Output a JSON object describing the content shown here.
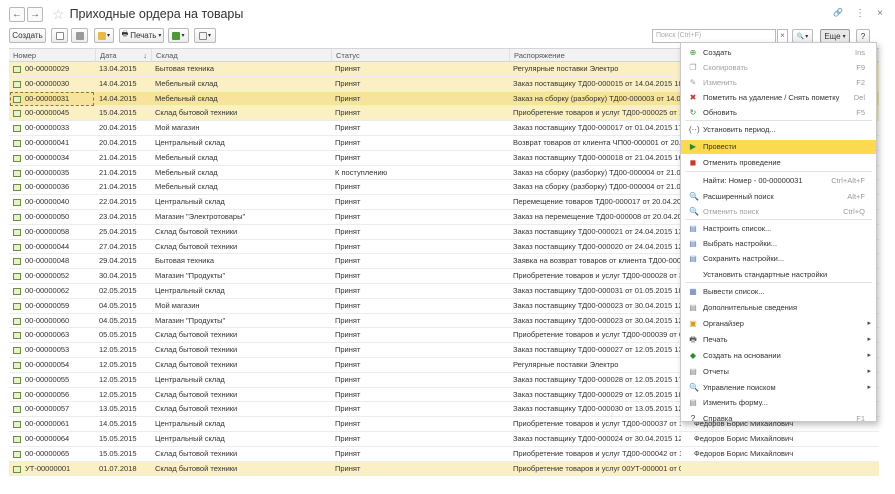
{
  "window": {
    "title": "Приходные ордера на товары",
    "back_glyph": "←",
    "forward_glyph": "→",
    "star_glyph": "☆",
    "link_glyph": "🔗",
    "more_glyph": "⋮",
    "close_glyph": "×"
  },
  "toolbar": {
    "create_label": "Создать",
    "print_label": "Печать",
    "search_placeholder": "Поиск (Ctrl+F)",
    "clear_glyph": "×",
    "search_glyph": "🔍",
    "more_label": "Еще",
    "help_label": "?",
    "dropdown_glyph": "▾"
  },
  "table": {
    "columns": [
      "Номер",
      "Дата",
      "Склад",
      "Статус",
      "Распоряжение"
    ],
    "sort_glyph": "↓",
    "rows": [
      {
        "num": "00-00000029",
        "date": "13.04.2015",
        "warehouse": "Бытовая техника",
        "status": "Принят",
        "order": "Регулярные поставки Электро",
        "state": "hl"
      },
      {
        "num": "00-00000030",
        "date": "14.04.2015",
        "warehouse": "Мебельный склад",
        "status": "Принят",
        "order": "Заказ поставщику ТД00-000015 от 14.04.2015 18:55:37",
        "state": "hl"
      },
      {
        "num": "00-00000031",
        "date": "14.04.2015",
        "warehouse": "Мебельный склад",
        "status": "Принят",
        "order": "Заказ на сборку (разборку) ТД00-000003 от 14.04.201",
        "state": "sel"
      },
      {
        "num": "00-00000045",
        "date": "15.04.2015",
        "warehouse": "Склад бытовой техники",
        "status": "Принят",
        "order": "Приобретение товаров и услуг ТД00-000025 от 15.04.2",
        "state": "hl"
      },
      {
        "num": "00-00000033",
        "date": "20.04.2015",
        "warehouse": "Мой магазин",
        "status": "Принят",
        "order": "Заказ поставщику ТД00-000017 от 01.04.2015 17:53:0",
        "state": ""
      },
      {
        "num": "00-00000041",
        "date": "20.04.2015",
        "warehouse": "Центральный склад",
        "status": "Принят",
        "order": "Возврат товаров от клиента ЧП00-000001 от 20.04.20",
        "state": ""
      },
      {
        "num": "00-00000034",
        "date": "21.04.2015",
        "warehouse": "Мебельный склад",
        "status": "Принят",
        "order": "Заказ поставщику ТД00-000018 от 21.04.2015 16:10:4",
        "state": ""
      },
      {
        "num": "00-00000035",
        "date": "21.04.2015",
        "warehouse": "Мебельный склад",
        "status": "К поступлению",
        "order": "Заказ на сборку (разборку) ТД00-000004 от 21.04.201",
        "state": ""
      },
      {
        "num": "00-00000036",
        "date": "21.04.2015",
        "warehouse": "Мебельный склад",
        "status": "Принят",
        "order": "Заказ на сборку (разборку) ТД00-000004 от 21.04.201",
        "state": ""
      },
      {
        "num": "00-00000040",
        "date": "22.04.2015",
        "warehouse": "Центральный склад",
        "status": "Принят",
        "order": "Перемещение товаров ТД00-000017 от 20.04.2015 19.",
        "state": ""
      },
      {
        "num": "00-00000050",
        "date": "23.04.2015",
        "warehouse": "Магазин \"Электротовары\"",
        "status": "Принят",
        "order": "Заказ на перемещение ТД00-000008 от 20.04.2015 1.",
        "state": ""
      },
      {
        "num": "00-00000058",
        "date": "25.04.2015",
        "warehouse": "Склад бытовой техники",
        "status": "Принят",
        "order": "Заказ поставщику ТД00-000021 от 24.04.2015 13:10:0",
        "state": ""
      },
      {
        "num": "00-00000044",
        "date": "27.04.2015",
        "warehouse": "Склад бытовой техники",
        "status": "Принят",
        "order": "Заказ поставщику ТД00-000020 от 24.04.2015 12:28:5",
        "state": ""
      },
      {
        "num": "00-00000048",
        "date": "29.04.2015",
        "warehouse": "Бытовая техника",
        "status": "Принят",
        "order": "Заявка на возврат товаров от клиента ТД00-000002 о.",
        "state": ""
      },
      {
        "num": "00-00000052",
        "date": "30.04.2015",
        "warehouse": "Магазин \"Продукты\"",
        "status": "Принят",
        "order": "Приобретение товаров и услуг ТД00-000028 от 30.04",
        "state": ""
      },
      {
        "num": "00-00000062",
        "date": "02.05.2015",
        "warehouse": "Центральный склад",
        "status": "Принят",
        "order": "Заказ поставщику ТД00-000031 от 01.05.2015 18:49:5",
        "state": ""
      },
      {
        "num": "00-00000059",
        "date": "04.05.2015",
        "warehouse": "Мой магазин",
        "status": "Принят",
        "order": "Заказ поставщику ТД00-000023 от 30.04.2015 12:08:2",
        "state": ""
      },
      {
        "num": "00-00000060",
        "date": "04.05.2015",
        "warehouse": "Магазин \"Продукты\"",
        "status": "Принят",
        "order": "Заказ поставщику ТД00-000023 от 30.04.2015 12:08:2",
        "state": ""
      },
      {
        "num": "00-00000063",
        "date": "05.05.2015",
        "warehouse": "Склад бытовой техники",
        "status": "Принят",
        "order": "Приобретение товаров и услуг ТД00-000039 от 05.05.",
        "state": ""
      },
      {
        "num": "00-00000053",
        "date": "12.05.2015",
        "warehouse": "Склад бытовой техники",
        "status": "Принят",
        "order": "Заказ поставщику ТД00-000027 от 12.05.2015 13:57:5",
        "state": ""
      },
      {
        "num": "00-00000054",
        "date": "12.05.2015",
        "warehouse": "Склад бытовой техники",
        "status": "Принят",
        "order": "Регулярные поставки Электро",
        "state": ""
      },
      {
        "num": "00-00000055",
        "date": "12.05.2015",
        "warehouse": "Центральный склад",
        "status": "Принят",
        "order": "Заказ поставщику ТД00-000028 от 12.05.2015 17:47:4",
        "state": ""
      },
      {
        "num": "00-00000056",
        "date": "12.05.2015",
        "warehouse": "Склад бытовой техники",
        "status": "Принят",
        "order": "Заказ поставщику ТД00-000029 от 12.05.2015 18:18:0",
        "state": ""
      },
      {
        "num": "00-00000057",
        "date": "13.05.2015",
        "warehouse": "Склад бытовой техники",
        "status": "Принят",
        "order": "Заказ поставщику ТД00-000030 от 13.05.2015 12:44:1",
        "state": ""
      },
      {
        "num": "00-00000061",
        "date": "14.05.2015",
        "warehouse": "Центральный склад",
        "status": "Принят",
        "order": "Приобретение товаров и услуг ТД00-000037 от 14.05.",
        "state": "",
        "resp": "Федоров Борис Михайлович"
      },
      {
        "num": "00-00000064",
        "date": "15.05.2015",
        "warehouse": "Центральный склад",
        "status": "Принят",
        "order": "Заказ поставщику ТД00-000024 от 30.04.2015 12:11:08",
        "state": "",
        "resp": "Федоров Борис Михайлович"
      },
      {
        "num": "00-00000065",
        "date": "15.05.2015",
        "warehouse": "Склад бытовой техники",
        "status": "Принят",
        "order": "Приобретение товаров и услуг ТД00-000042 от 15.05.2",
        "state": "",
        "resp": "Федоров Борис Михайлович"
      },
      {
        "num": "УТ-00000001",
        "date": "01.07.2018",
        "warehouse": "Склад бытовой техники",
        "status": "Принят",
        "order": "Приобретение товаров и услуг 00УТ-000001 от 01.07.",
        "state": "hl",
        "resp": ""
      }
    ]
  },
  "menu": {
    "items": [
      {
        "label": "Создать",
        "key": "Ins",
        "icon": "⊕",
        "color": "#3a9a3a",
        "disabled": false
      },
      {
        "label": "Скопировать",
        "key": "F9",
        "icon": "❐",
        "color": "#a0a0a0",
        "disabled": true
      },
      {
        "label": "Изменить",
        "key": "F2",
        "icon": "✎",
        "color": "#a0a0a0",
        "disabled": true
      },
      {
        "label": "Пометить на удаление / Снять пометку",
        "key": "Del",
        "icon": "✖",
        "color": "#c43b2b",
        "disabled": false
      },
      {
        "label": "Обновить",
        "key": "F5",
        "icon": "↻",
        "color": "#2f8a2f",
        "disabled": false
      },
      {
        "label": "Установить период...",
        "key": "",
        "icon": "(··)",
        "color": "#555555",
        "disabled": false
      },
      {
        "label": "Провести",
        "key": "",
        "icon": "▶",
        "color": "#2f8a2f",
        "disabled": false,
        "active": true
      },
      {
        "label": "Отменить проведение",
        "key": "",
        "icon": "◼",
        "color": "#c43b2b",
        "disabled": false
      },
      {
        "label": "Найти: Номер - 00-00000031",
        "key": "Ctrl+Alt+F",
        "icon": "",
        "color": "#555555",
        "disabled": false
      },
      {
        "label": "Расширенный поиск",
        "key": "Alt+F",
        "icon": "🔍",
        "color": "#555555",
        "disabled": false
      },
      {
        "label": "Отменить поиск",
        "key": "Ctrl+Q",
        "icon": "🔍",
        "color": "#a0a0a0",
        "disabled": true
      },
      {
        "label": "Настроить список...",
        "key": "",
        "icon": "▤",
        "color": "#5a7ab0",
        "disabled": false
      },
      {
        "label": "Выбрать настройки...",
        "key": "",
        "icon": "▤",
        "color": "#5a7ab0",
        "disabled": false
      },
      {
        "label": "Сохранить настройки...",
        "key": "",
        "icon": "▤",
        "color": "#5a7ab0",
        "disabled": false
      },
      {
        "label": "Установить стандартные настройки",
        "key": "",
        "icon": "",
        "color": "#555555",
        "disabled": false
      },
      {
        "label": "Вывести список...",
        "key": "",
        "icon": "▦",
        "color": "#5a7ab0",
        "disabled": false
      },
      {
        "label": "Дополнительные сведения",
        "key": "",
        "icon": "▤",
        "color": "#888888",
        "disabled": false
      },
      {
        "label": "Органайзер",
        "key": "",
        "icon": "▣",
        "color": "#d89a2b",
        "disabled": false,
        "submenu": true
      },
      {
        "label": "Печать",
        "key": "",
        "icon": "🖶",
        "color": "#555555",
        "disabled": false,
        "submenu": true
      },
      {
        "label": "Создать на основании",
        "key": "",
        "icon": "◆",
        "color": "#2f8a2f",
        "disabled": false,
        "submenu": true
      },
      {
        "label": "Отчеты",
        "key": "",
        "icon": "▤",
        "color": "#888888",
        "disabled": false,
        "submenu": true
      },
      {
        "label": "Управление поиском",
        "key": "",
        "icon": "🔍",
        "color": "#555555",
        "disabled": false,
        "submenu": true
      },
      {
        "label": "Изменить форму...",
        "key": "",
        "icon": "▤",
        "color": "#888888",
        "disabled": false
      },
      {
        "label": "Справка",
        "key": "F1",
        "icon": "?",
        "color": "#333333",
        "disabled": false
      }
    ],
    "submenu_glyph": "▸"
  }
}
